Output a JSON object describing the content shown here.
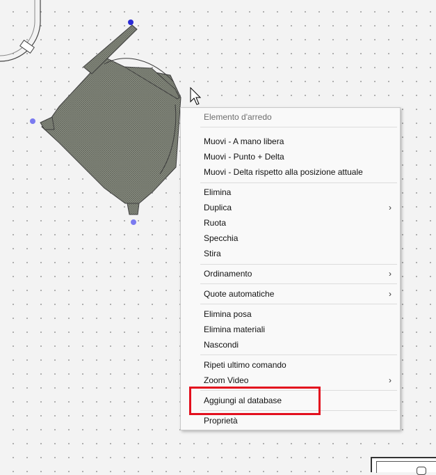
{
  "context_menu": {
    "header": "Elemento d'arredo",
    "move_freehand": "Muovi - A mano libera",
    "move_point_delta": "Muovi - Punto + Delta",
    "move_delta_current": "Muovi - Delta rispetto alla posizione attuale",
    "delete": "Elimina",
    "duplicate": "Duplica",
    "rotate": "Ruota",
    "mirror": "Specchia",
    "stretch": "Stira",
    "ordering": "Ordinamento",
    "auto_dimensions": "Quote automatiche",
    "delete_installation": "Elimina posa",
    "delete_materials": "Elimina materiali",
    "hide": "Nascondi",
    "repeat_last": "Ripeti ultimo comando",
    "zoom_video": "Zoom Video",
    "add_to_database": "Aggiungi al database",
    "properties": "Proprietà"
  },
  "icons": {
    "submenu": "chevron-right-icon",
    "cursor": "mouse-pointer-icon"
  },
  "colors": {
    "highlight": "#e3101e",
    "selection_handle": "#2a2ad6",
    "selection_handle_light": "#7a7af0",
    "furniture_fill": "#8e9286"
  }
}
